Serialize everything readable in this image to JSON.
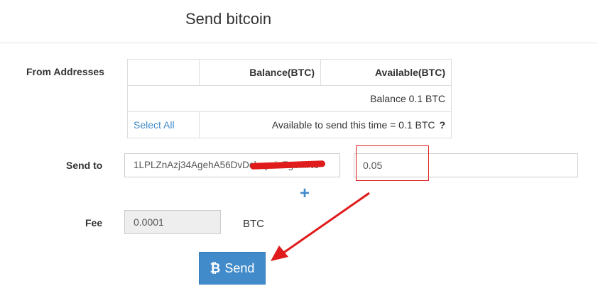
{
  "header": {
    "title": "Send bitcoin"
  },
  "labels": {
    "from": "From Addresses",
    "send_to": "Send to",
    "fee": "Fee"
  },
  "table": {
    "columns": [
      "",
      "Balance(BTC)",
      "Available(BTC)"
    ],
    "balance_row": "Balance 0.1 BTC",
    "select_all": "Select All",
    "available_text": "Available to send this time = 0.1 BTC",
    "help_mark": "?"
  },
  "send_to": {
    "address": "1LPLZnAzj34AgehA56DvDchoyuinZgeMNo",
    "amount": "0.05"
  },
  "add_recipient": "+",
  "fee": {
    "value": "0.0001",
    "unit": "BTC"
  },
  "send_button": {
    "icon": "bitcoin-icon",
    "glyph": "₿",
    "label": "Send"
  },
  "annotation": {
    "color": "#e01b1b"
  },
  "colors": {
    "primary": "#428bca"
  }
}
